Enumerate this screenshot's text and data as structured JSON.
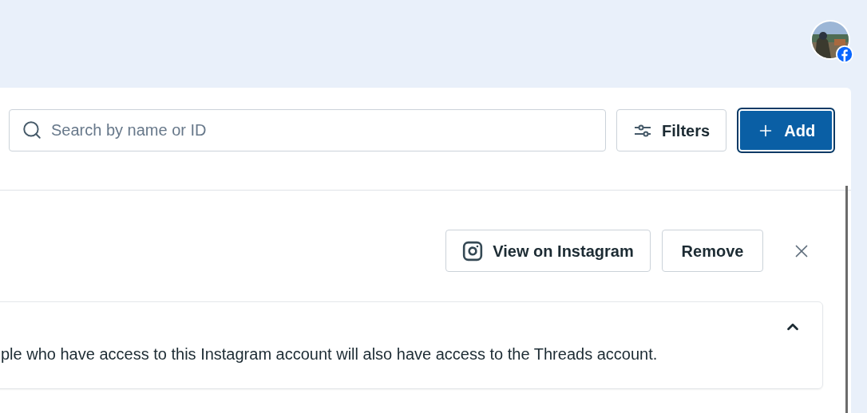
{
  "search": {
    "placeholder": "Search by name or ID"
  },
  "toolbar": {
    "filters": "Filters",
    "add": "Add"
  },
  "actions": {
    "view": "View on Instagram",
    "remove": "Remove"
  },
  "notice": {
    "expanded": true,
    "text": "ple who have access to this Instagram account will also have access to the Threads account."
  }
}
